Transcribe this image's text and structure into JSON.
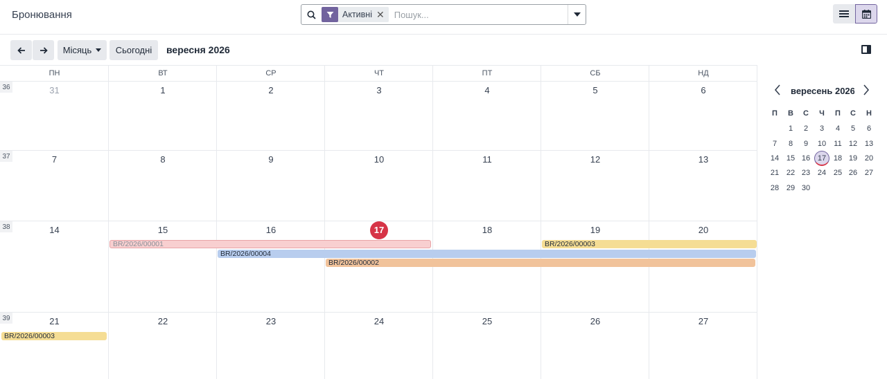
{
  "breadcrumb": "Бронювання",
  "search": {
    "facet_value": "Активні",
    "placeholder": "Пошук..."
  },
  "toolbar": {
    "scale_label": "Місяць",
    "today_label": "Сьогодні",
    "period": "вересня 2026"
  },
  "weekdays": [
    "ПН",
    "ВТ",
    "СР",
    "ЧТ",
    "ПТ",
    "СБ",
    "НД"
  ],
  "weeks": [
    {
      "number": "36",
      "days": [
        "31",
        "1",
        "2",
        "3",
        "4",
        "5",
        "6"
      ]
    },
    {
      "number": "37",
      "days": [
        "7",
        "8",
        "9",
        "10",
        "11",
        "12",
        "13"
      ]
    },
    {
      "number": "38",
      "days": [
        "14",
        "15",
        "16",
        "17",
        "18",
        "19",
        "20"
      ]
    },
    {
      "number": "39",
      "days": [
        "21",
        "22",
        "23",
        "24",
        "25",
        "26",
        "27"
      ]
    }
  ],
  "today": "17",
  "events": [
    {
      "name": "BR/2026/00001",
      "color": "#f8cfd0"
    },
    {
      "name": "BR/2026/00003",
      "color": "#f5dd94"
    },
    {
      "name": "BR/2026/00004",
      "color": "#b8cdee"
    },
    {
      "name": "BR/2026/00002",
      "color": "#f1c39b"
    },
    {
      "name": "BR/2026/00003",
      "color": "#f5dd94"
    }
  ],
  "mini": {
    "title": "вересень 2026",
    "weekdays": [
      "П",
      "В",
      "С",
      "Ч",
      "П",
      "С",
      "Н"
    ],
    "rows": [
      [
        "",
        "1",
        "2",
        "3",
        "4",
        "5",
        "6"
      ],
      [
        "7",
        "8",
        "9",
        "10",
        "11",
        "12",
        "13"
      ],
      [
        "14",
        "15",
        "16",
        "17",
        "18",
        "19",
        "20"
      ],
      [
        "21",
        "22",
        "23",
        "24",
        "25",
        "26",
        "27"
      ],
      [
        "28",
        "29",
        "30",
        "",
        "",
        "",
        ""
      ]
    ]
  },
  "colors": {
    "accent": "#71639e",
    "today": "#d63447"
  }
}
